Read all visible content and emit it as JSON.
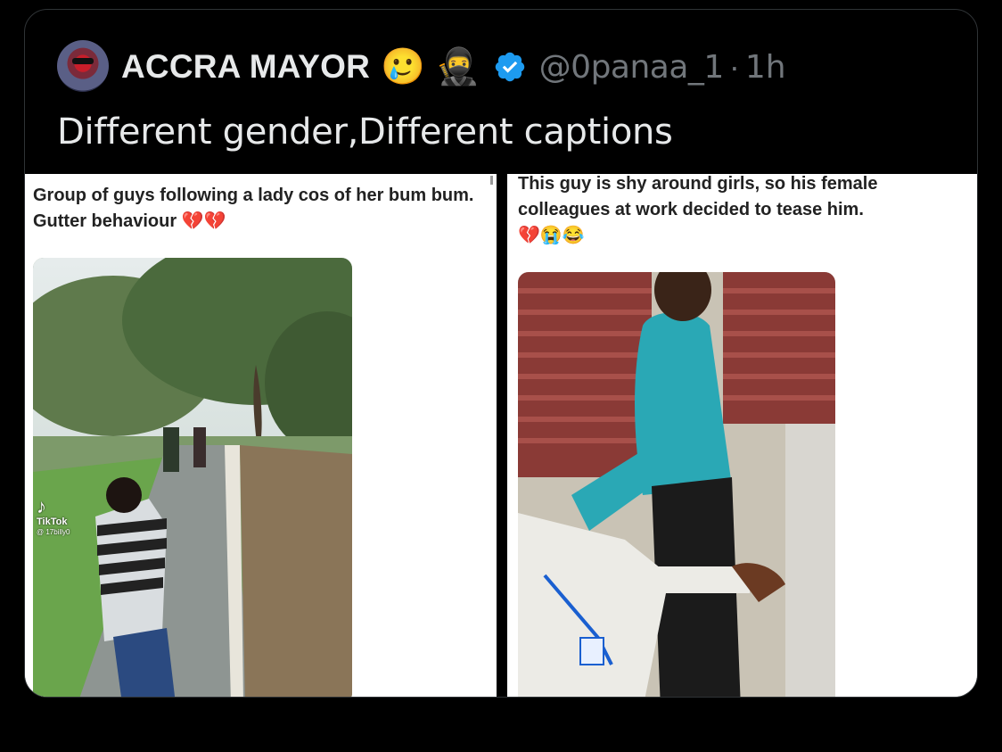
{
  "tweet": {
    "display_name": "ACCRA MAYOR",
    "emoji_1": "🥲",
    "emoji_2": "🥷",
    "handle": "@0panaa_1",
    "separator": "·",
    "time": "1h",
    "text": "Different gender,Different captions",
    "verified_color": "#1d9bf0"
  },
  "media": {
    "left_post": {
      "caption": "Group of guys following a lady cos of her bum bum. Gutter behaviour 💔💔",
      "watermark_brand": "TikTok",
      "watermark_user": "@ 17billy0"
    },
    "right_post": {
      "caption": "This guy is shy around girls, so his female colleagues at work decided to tease him.",
      "emojis": "💔😭😂"
    }
  }
}
